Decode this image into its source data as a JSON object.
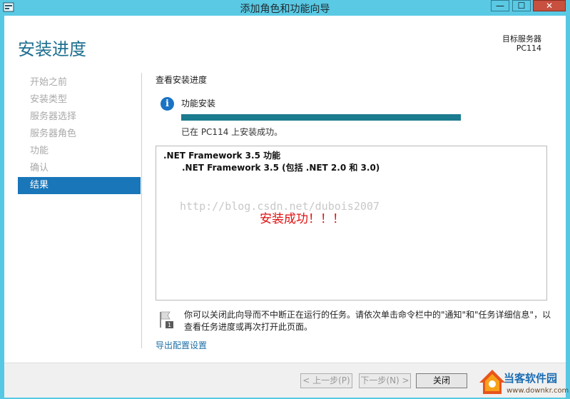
{
  "window": {
    "title": "添加角色和功能向导",
    "controls": {
      "minimize": "—",
      "maximize": "☐",
      "close": "✕"
    }
  },
  "page": {
    "title": "安装进度",
    "target_label": "目标服务器",
    "target_value": "PC114"
  },
  "sidebar": {
    "items": [
      {
        "label": "开始之前",
        "active": false
      },
      {
        "label": "安装类型",
        "active": false
      },
      {
        "label": "服务器选择",
        "active": false
      },
      {
        "label": "服务器角色",
        "active": false
      },
      {
        "label": "功能",
        "active": false
      },
      {
        "label": "确认",
        "active": false
      },
      {
        "label": "结果",
        "active": true
      }
    ]
  },
  "content": {
    "section_title": "查看安装进度",
    "install_label": "功能安装",
    "progress_percent": 100,
    "status": "已在 PC114 上安装成功。",
    "results": {
      "feature": ".NET Framework 3.5 功能",
      "sub_feature": ".NET Framework 3.5 (包括 .NET 2.0 和 3.0)"
    },
    "watermark": "http://blog.csdn.net/dubois2007",
    "success_stamp": "安装成功！！！",
    "notice": "你可以关闭此向导而不中断正在运行的任务。请依次单击命令栏中的\"通知\"和\"任务详细信息\"，以查看任务进度或再次打开此页面。",
    "export_link": "导出配置设置"
  },
  "footer": {
    "prev": "< 上一步(P)",
    "next": "下一步(N) >",
    "close": "关闭"
  },
  "logo": {
    "name": "当客软件园",
    "url": "www.downkr.com"
  },
  "colors": {
    "titlebar": "#5ac9e4",
    "accent": "#1976b9",
    "title_text": "#1e6f8f",
    "progress": "#1b7b8f"
  }
}
